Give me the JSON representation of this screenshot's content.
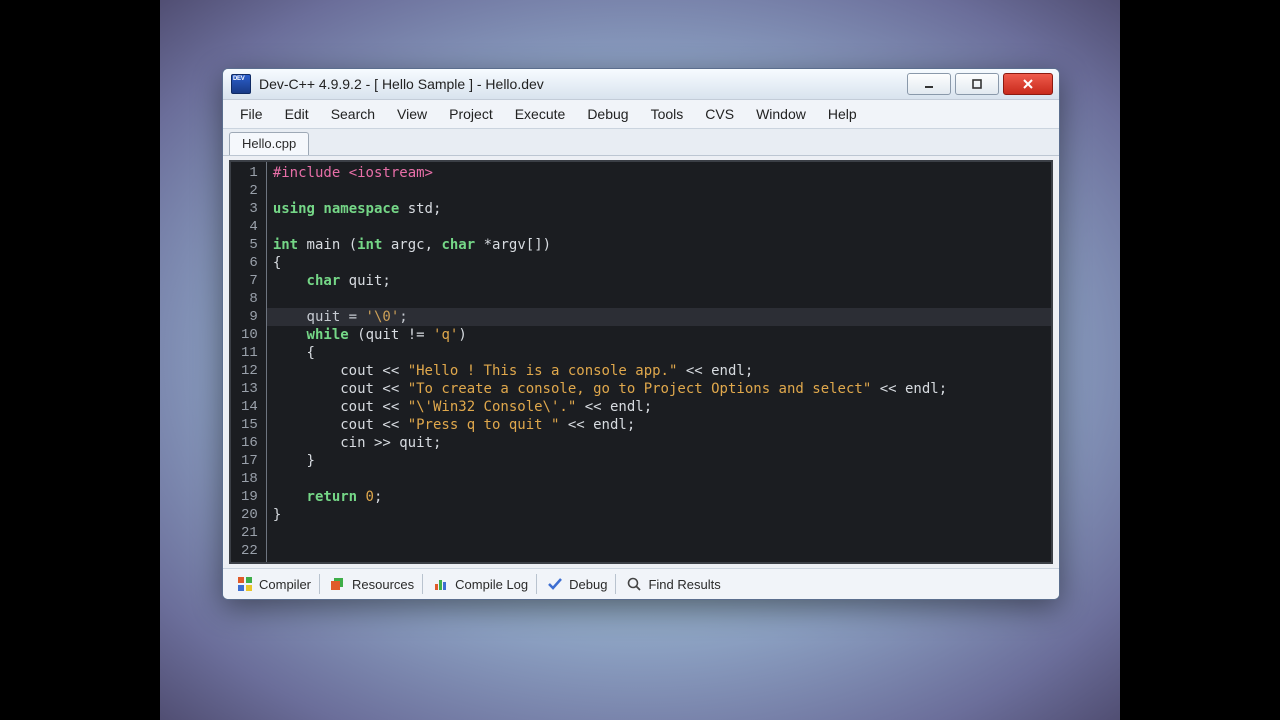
{
  "window": {
    "title": "Dev-C++ 4.9.9.2  -  [ Hello Sample ]  -  Hello.dev"
  },
  "menu": {
    "items": [
      "File",
      "Edit",
      "Search",
      "View",
      "Project",
      "Execute",
      "Debug",
      "Tools",
      "CVS",
      "Window",
      "Help"
    ]
  },
  "tabs": {
    "items": [
      "Hello.cpp"
    ]
  },
  "code": {
    "highlight_line": 9,
    "lines": [
      {
        "n": 1,
        "html": "<span class='tok-pre'>#include</span> <span class='tok-inc'>&lt;iostream&gt;</span>"
      },
      {
        "n": 2,
        "html": ""
      },
      {
        "n": 3,
        "html": "<span class='tok-kw'>using</span> <span class='tok-kw'>namespace</span> std<span class='tok-punc'>;</span>"
      },
      {
        "n": 4,
        "html": ""
      },
      {
        "n": 5,
        "html": "<span class='tok-type'>int</span> main <span class='tok-punc'>(</span><span class='tok-type'>int</span> argc<span class='tok-punc'>,</span> <span class='tok-type'>char</span> <span class='tok-op'>*</span>argv<span class='tok-punc'>[</span><span class='tok-punc'>]</span><span class='tok-punc'>)</span>"
      },
      {
        "n": 6,
        "html": "<span class='tok-punc'>{</span>"
      },
      {
        "n": 7,
        "html": "    <span class='tok-type'>char</span> quit<span class='tok-punc'>;</span>"
      },
      {
        "n": 8,
        "html": ""
      },
      {
        "n": 9,
        "html": "    quit <span class='tok-op'>=</span> <span class='tok-str'>'\\0'</span><span class='tok-punc'>;</span>"
      },
      {
        "n": 10,
        "html": "    <span class='tok-kw'>while</span> <span class='tok-punc'>(</span>quit <span class='tok-op'>!=</span> <span class='tok-str'>'q'</span><span class='tok-punc'>)</span>"
      },
      {
        "n": 11,
        "html": "    <span class='tok-punc'>{</span>"
      },
      {
        "n": 12,
        "html": "        cout <span class='tok-op'>&lt;&lt;</span> <span class='tok-str'>\"Hello ! This is a console app.\"</span> <span class='tok-op'>&lt;&lt;</span> endl<span class='tok-punc'>;</span>"
      },
      {
        "n": 13,
        "html": "        cout <span class='tok-op'>&lt;&lt;</span> <span class='tok-str'>\"To create a console, go to Project Options and select\"</span> <span class='tok-op'>&lt;&lt;</span> endl<span class='tok-punc'>;</span>"
      },
      {
        "n": 14,
        "html": "        cout <span class='tok-op'>&lt;&lt;</span> <span class='tok-str'>\"\\'Win32 Console\\'.\"</span> <span class='tok-op'>&lt;&lt;</span> endl<span class='tok-punc'>;</span>"
      },
      {
        "n": 15,
        "html": "        cout <span class='tok-op'>&lt;&lt;</span> <span class='tok-str'>\"Press q to quit \"</span> <span class='tok-op'>&lt;&lt;</span> endl<span class='tok-punc'>;</span>"
      },
      {
        "n": 16,
        "html": "        cin <span class='tok-op'>&gt;&gt;</span> quit<span class='tok-punc'>;</span>"
      },
      {
        "n": 17,
        "html": "    <span class='tok-punc'>}</span>"
      },
      {
        "n": 18,
        "html": ""
      },
      {
        "n": 19,
        "html": "    <span class='tok-kw'>return</span> <span class='tok-num'>0</span><span class='tok-punc'>;</span>"
      },
      {
        "n": 20,
        "html": "<span class='tok-punc'>}</span>"
      },
      {
        "n": 21,
        "html": ""
      },
      {
        "n": 22,
        "html": ""
      }
    ]
  },
  "status": {
    "items": [
      "Compiler",
      "Resources",
      "Compile Log",
      "Debug",
      "Find Results"
    ]
  }
}
